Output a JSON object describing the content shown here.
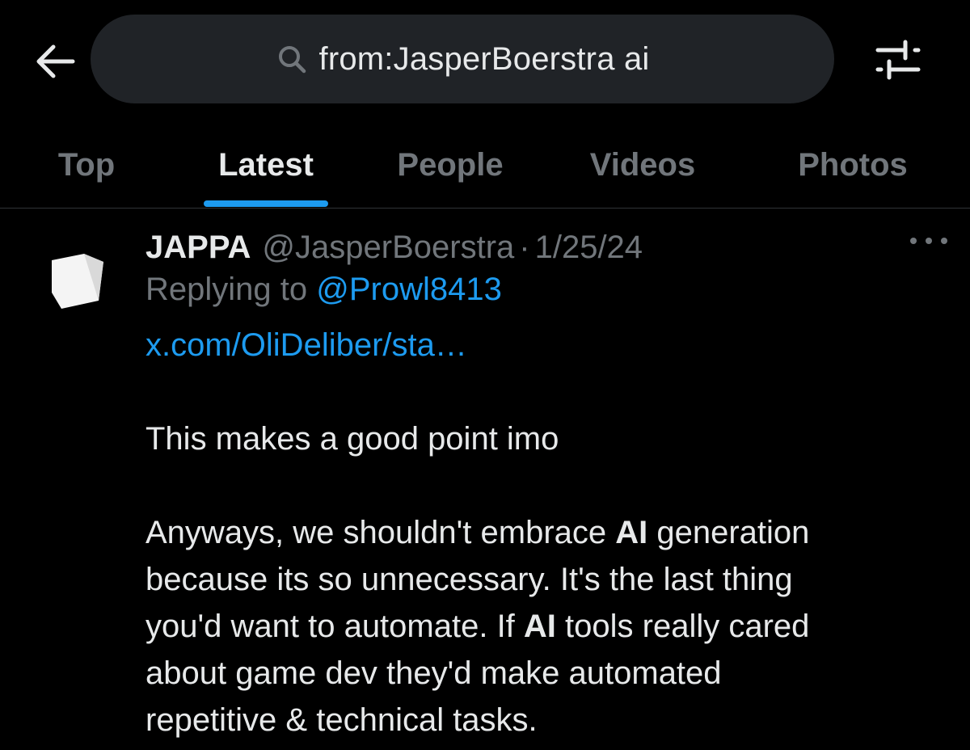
{
  "search": {
    "query": "from:JasperBoerstra ai",
    "icon": "search-icon"
  },
  "header": {
    "back_icon": "arrow-left-icon",
    "filter_icon": "sliders-icon"
  },
  "tabs": [
    {
      "label": "Top",
      "active": false
    },
    {
      "label": "Latest",
      "active": true
    },
    {
      "label": "People",
      "active": false
    },
    {
      "label": "Videos",
      "active": false
    },
    {
      "label": "Photos",
      "active": false
    }
  ],
  "tweet": {
    "author_name": "JAPPA",
    "author_handle": "@JasperBoerstra",
    "separator": "·",
    "date": "1/25/24",
    "replying_prefix": "Replying to",
    "replying_to": "@Prowl8413",
    "link": "x.com/OliDeliber/sta…",
    "line1": "This makes a good point imo",
    "para2": {
      "l1_a": "Anyways, we shouldn't embrace ",
      "l1_hl": "AI",
      "l1_b": " generation",
      "l2": "because its so unnecessary. It's the last thing",
      "l3_a": "you'd want to automate. If ",
      "l3_hl": "AI",
      "l3_b": " tools really cared",
      "l4": "about game dev they'd make automated",
      "l5": "repetitive & technical tasks."
    }
  },
  "colors": {
    "background": "#000000",
    "text": "#e7e9ea",
    "muted": "#71767b",
    "accent": "#1d9bf0",
    "search_bg": "#202327"
  }
}
